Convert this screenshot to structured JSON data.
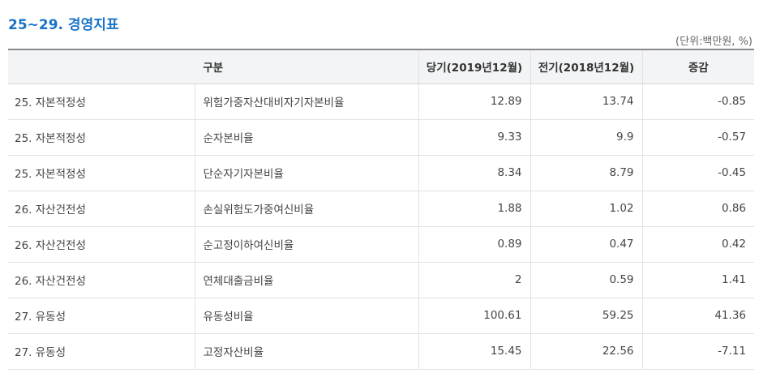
{
  "title": "25~29. 경영지표",
  "unit_label": "(단위:백만원, %)",
  "columns": {
    "category": "구분",
    "current": "당기(2019년12월)",
    "previous": "전기(2018년12월)",
    "change": "증감"
  },
  "rows": [
    {
      "category": "25. 자본적정성",
      "item": "위험가중자산대비자기자본비율",
      "current": "12.89",
      "previous": "13.74",
      "change": "-0.85"
    },
    {
      "category": "25. 자본적정성",
      "item": "순자본비율",
      "current": "9.33",
      "previous": "9.9",
      "change": "-0.57"
    },
    {
      "category": "25. 자본적정성",
      "item": "단순자기자본비율",
      "current": "8.34",
      "previous": "8.79",
      "change": "-0.45"
    },
    {
      "category": "26. 자산건전성",
      "item": "손실위험도가중여신비율",
      "current": "1.88",
      "previous": "1.02",
      "change": "0.86"
    },
    {
      "category": "26. 자산건전성",
      "item": "순고정이하여신비율",
      "current": "0.89",
      "previous": "0.47",
      "change": "0.42"
    },
    {
      "category": "26. 자산건전성",
      "item": "연체대출금비율",
      "current": "2",
      "previous": "0.59",
      "change": "1.41"
    },
    {
      "category": "27. 유동성",
      "item": "유동성비율",
      "current": "100.61",
      "previous": "59.25",
      "change": "41.36"
    },
    {
      "category": "27. 유동성",
      "item": "고정자산비율",
      "current": "15.45",
      "previous": "22.56",
      "change": "-7.11"
    }
  ]
}
